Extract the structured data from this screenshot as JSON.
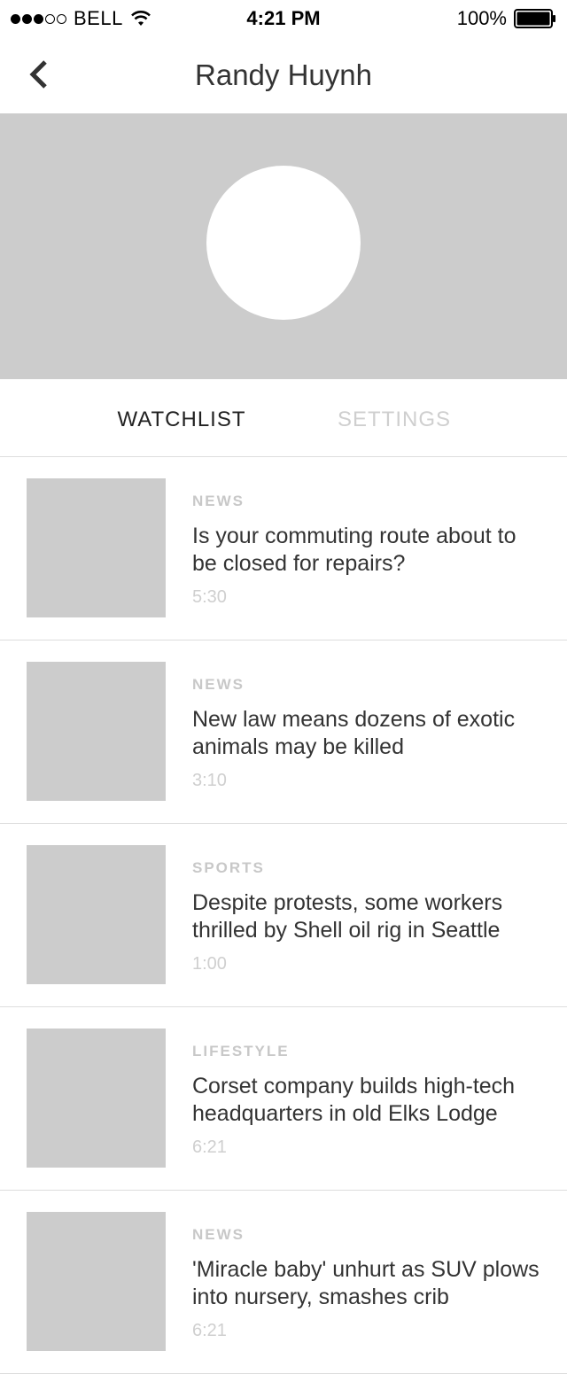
{
  "status_bar": {
    "carrier": "BELL",
    "time": "4:21 PM",
    "battery": "100%"
  },
  "nav": {
    "title": "Randy Huynh"
  },
  "tabs": [
    {
      "label": "WATCHLIST",
      "active": true
    },
    {
      "label": "SETTINGS",
      "active": false
    }
  ],
  "items": [
    {
      "category": "NEWS",
      "headline": "Is your commuting route about to be closed for repairs?",
      "duration": "5:30"
    },
    {
      "category": "NEWS",
      "headline": "New law means dozens of exotic animals may be killed",
      "duration": "3:10"
    },
    {
      "category": "SPORTS",
      "headline": "Despite protests, some workers thrilled by Shell oil rig in Seattle",
      "duration": "1:00"
    },
    {
      "category": "LIFESTYLE",
      "headline": "Corset company builds high-tech headquarters in old Elks Lodge",
      "duration": "6:21"
    },
    {
      "category": "NEWS",
      "headline": "'Miracle baby' unhurt as SUV plows into nursery, smashes crib",
      "duration": "6:21"
    }
  ]
}
